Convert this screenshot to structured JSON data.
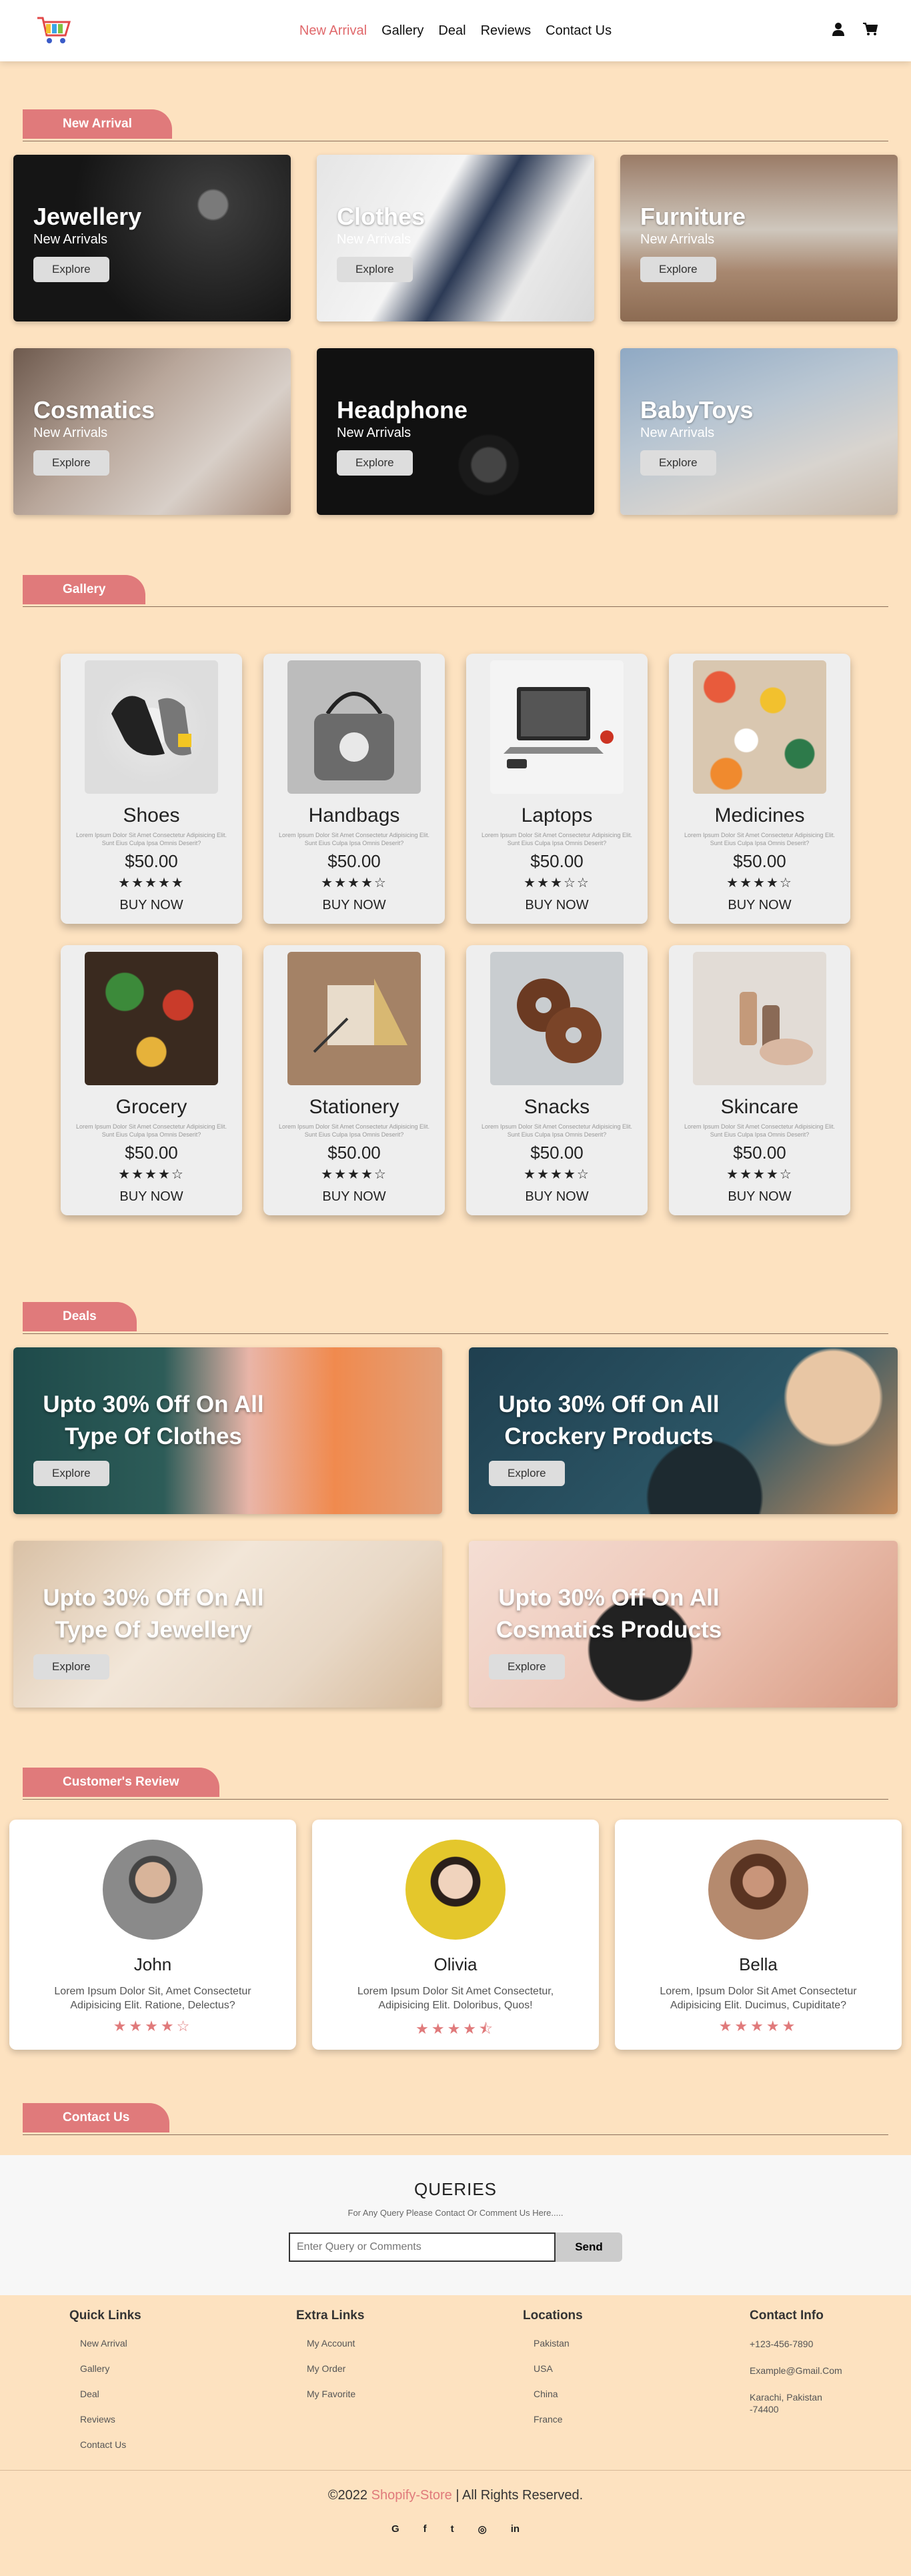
{
  "nav": {
    "items": [
      "New Arrival",
      "Gallery",
      "Deal",
      "Reviews",
      "Contact Us"
    ],
    "active": "New Arrival",
    "icons": [
      "user-icon",
      "cart-icon"
    ]
  },
  "new_arrival": {
    "title": "New Arrival",
    "cards": [
      {
        "name": "Jewellery",
        "sub": "New Arrivals",
        "btn": "Explore"
      },
      {
        "name": "Clothes",
        "sub": "New Arrivals",
        "btn": "Explore"
      },
      {
        "name": "Furniture",
        "sub": "New Arrivals",
        "btn": "Explore"
      },
      {
        "name": "Cosmatics",
        "sub": "New Arrivals",
        "btn": "Explore"
      },
      {
        "name": "Headphone",
        "sub": "New Arrivals",
        "btn": "Explore"
      },
      {
        "name": "BabyToys",
        "sub": "New Arrivals",
        "btn": "Explore"
      }
    ]
  },
  "gallery": {
    "title": "Gallery",
    "desc": "Lorem Ipsum Dolor Sit Amet Consectetur Adipisicing Elit. Sunt Eius Culpa Ipsa Omnis Deserit?",
    "products": [
      {
        "name": "Shoes",
        "price": "$50.00",
        "stars": "★★★★★",
        "rating": 5,
        "btn": "BUY NOW"
      },
      {
        "name": "Handbags",
        "price": "$50.00",
        "stars": "★★★★☆",
        "rating": 4,
        "btn": "BUY NOW"
      },
      {
        "name": "Laptops",
        "price": "$50.00",
        "stars": "★★★☆☆",
        "rating": 3,
        "btn": "BUY NOW"
      },
      {
        "name": "Medicines",
        "price": "$50.00",
        "stars": "★★★★☆",
        "rating": 4,
        "btn": "BUY NOW"
      },
      {
        "name": "Grocery",
        "price": "$50.00",
        "stars": "★★★★☆",
        "rating": 4,
        "btn": "BUY NOW"
      },
      {
        "name": "Stationery",
        "price": "$50.00",
        "stars": "★★★★☆",
        "rating": 4,
        "btn": "BUY NOW"
      },
      {
        "name": "Snacks",
        "price": "$50.00",
        "stars": "★★★★☆",
        "rating": 4,
        "btn": "BUY NOW"
      },
      {
        "name": "Skincare",
        "price": "$50.00",
        "stars": "★★★★☆",
        "rating": 4,
        "btn": "BUY NOW"
      }
    ]
  },
  "deals": {
    "title": "Deals",
    "items": [
      {
        "text": "Upto 30% Off On All Type Of Clothes",
        "btn": "Explore"
      },
      {
        "text": "Upto 30% Off On All Crockery Products",
        "btn": "Explore"
      },
      {
        "text": "Upto 30% Off On All Type Of Jewellery",
        "btn": "Explore"
      },
      {
        "text": "Upto 30% Off On All Cosmatics Products",
        "btn": "Explore"
      }
    ]
  },
  "reviews": {
    "title": "Customer's Review",
    "items": [
      {
        "name": "John",
        "text": "Lorem Ipsum Dolor Sit, Amet Consectetur Adipisicing Elit. Ratione, Delectus?",
        "stars": "★★★★☆",
        "rating": 4
      },
      {
        "name": "Olivia",
        "text": "Lorem Ipsum Dolor Sit Amet Consectetur, Adipisicing Elit. Doloribus, Quos!",
        "stars": "★★★★⯪",
        "rating": 4.5
      },
      {
        "name": "Bella",
        "text": "Lorem, Ipsum Dolor Sit Amet Consectetur Adipisicing Elit. Ducimus, Cupiditate?",
        "stars": "★★★★★",
        "rating": 5
      }
    ]
  },
  "contact": {
    "title": "Contact Us",
    "heading": "QUERIES",
    "subheading": "For Any Query Please Contact Or Comment Us Here.....",
    "placeholder": "Enter Query or Comments",
    "send": "Send"
  },
  "footer": {
    "quick_links": {
      "title": "Quick Links",
      "items": [
        "New Arrival",
        "Gallery",
        "Deal",
        "Reviews",
        "Contact Us"
      ]
    },
    "extra_links": {
      "title": "Extra Links",
      "items": [
        "My Account",
        "My Order",
        "My Favorite"
      ]
    },
    "locations": {
      "title": "Locations",
      "items": [
        "Pakistan",
        "USA",
        "China",
        "France"
      ]
    },
    "contact_info": {
      "title": "Contact Info",
      "items": [
        "+123-456-7890",
        "Example@Gmail.Com",
        "Karachi, Pakistan -74400"
      ]
    },
    "copyright_pre": "©2022",
    "brand": "Shopify-Store",
    "copyright_post": "| All Rights Reserved.",
    "socials": [
      "G",
      "f",
      "t",
      "◎",
      "in"
    ]
  },
  "colors": {
    "accent": "#e07a7b",
    "background": "#fde2c0"
  }
}
